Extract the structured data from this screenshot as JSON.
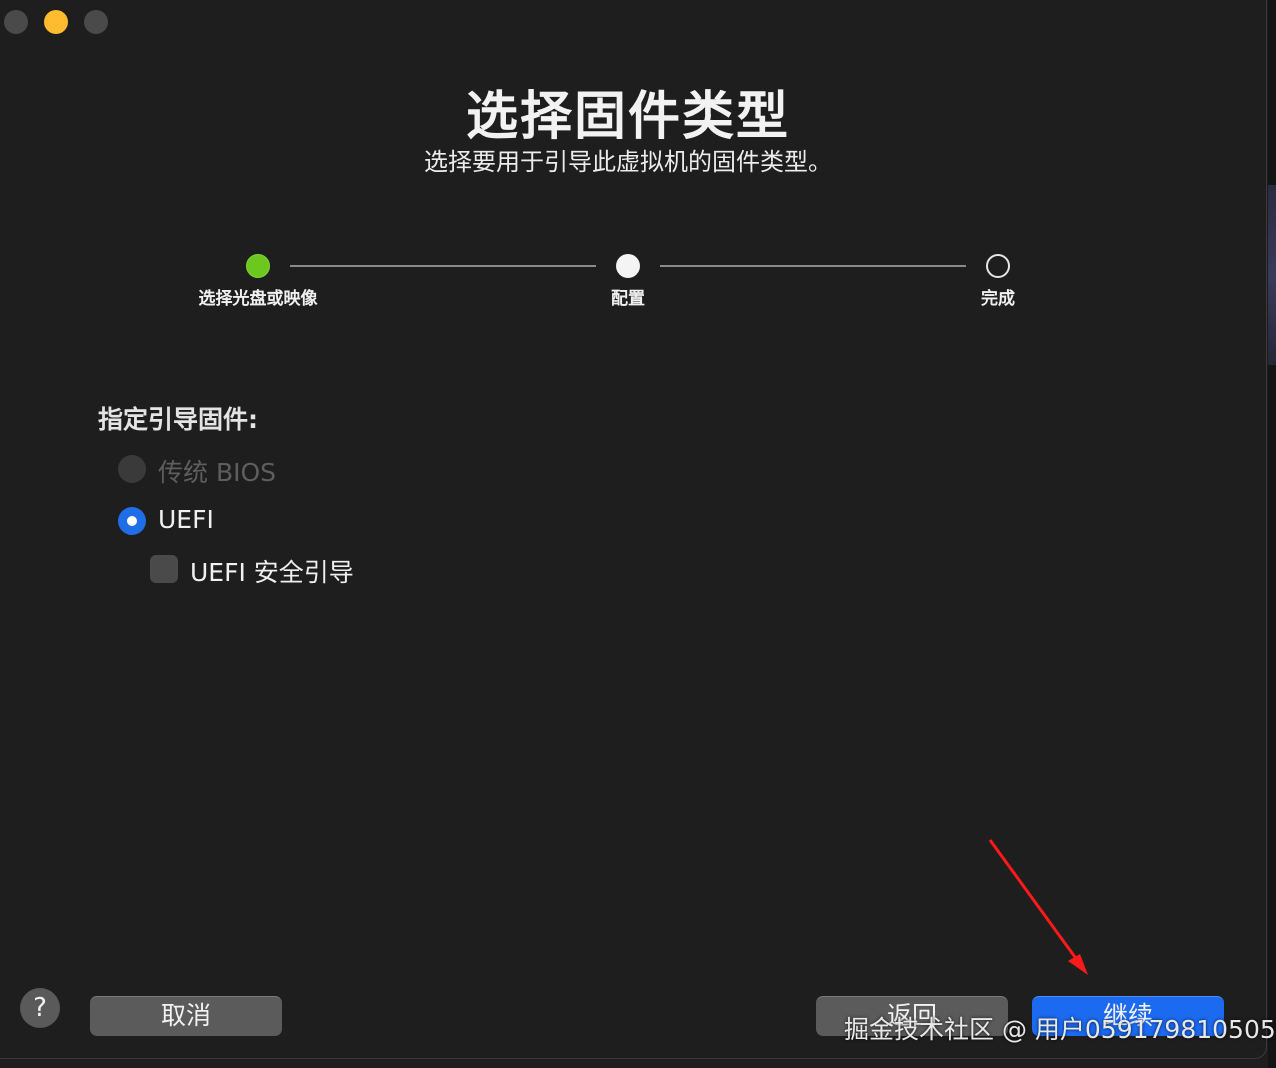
{
  "header": {
    "title": "选择固件类型",
    "subtitle": "选择要用于引导此虚拟机的固件类型。"
  },
  "steps": [
    {
      "label": "选择光盘或映像",
      "state": "done"
    },
    {
      "label": "配置",
      "state": "current"
    },
    {
      "label": "完成",
      "state": "todo"
    }
  ],
  "firmware": {
    "section_label": "指定引导固件:",
    "options": [
      {
        "label": "传统 BIOS",
        "selected": false,
        "enabled": false
      },
      {
        "label": "UEFI",
        "selected": true,
        "enabled": true
      }
    ],
    "secure_boot": {
      "label": "UEFI 安全引导",
      "checked": false
    }
  },
  "footer": {
    "help_label": "?",
    "cancel_label": "取消",
    "back_label": "返回",
    "continue_label": "继续"
  },
  "watermark": "掘金技术社区 @ 用户059179810505",
  "colors": {
    "accent": "#1b6af0",
    "step_done": "#6cc81e",
    "close_button": "#4a4a4a",
    "minimize_button": "#febc2e",
    "annotation_arrow": "#ff1a1a"
  }
}
